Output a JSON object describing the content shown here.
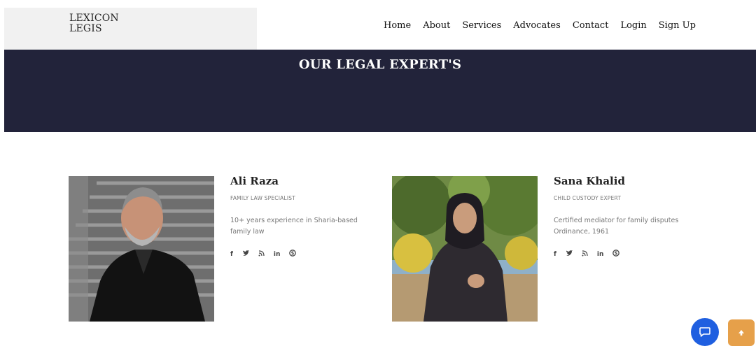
{
  "brand": {
    "line1": "LEXICON",
    "line2": "LEGIS"
  },
  "nav": [
    "Home",
    "About",
    "Services",
    "Advocates",
    "Contact",
    "Login",
    "Sign Up"
  ],
  "banner": {
    "title": "OUR LEGAL EXPERT'S"
  },
  "experts": [
    {
      "name": "Ali Raza",
      "role": "FAMILY LAW SPECIALIST",
      "description": "10+ years experience in Sharia-based family law",
      "social": [
        "f",
        "🐦",
        "rss",
        "in",
        "S"
      ]
    },
    {
      "name": "Sana Khalid",
      "role": "CHILD CUSTODY EXPERT",
      "description": "Certified mediator for family disputes Ordinance, 1961",
      "social": [
        "f",
        "🐦",
        "rss",
        "in",
        "S"
      ]
    }
  ],
  "colors": {
    "banner": "#22233a",
    "chat": "#1f5fe0",
    "scroll_top": "#e6a04a"
  },
  "icons": {
    "chat": "chat-bubble-icon",
    "scroll_top": "arrow-up-icon"
  }
}
